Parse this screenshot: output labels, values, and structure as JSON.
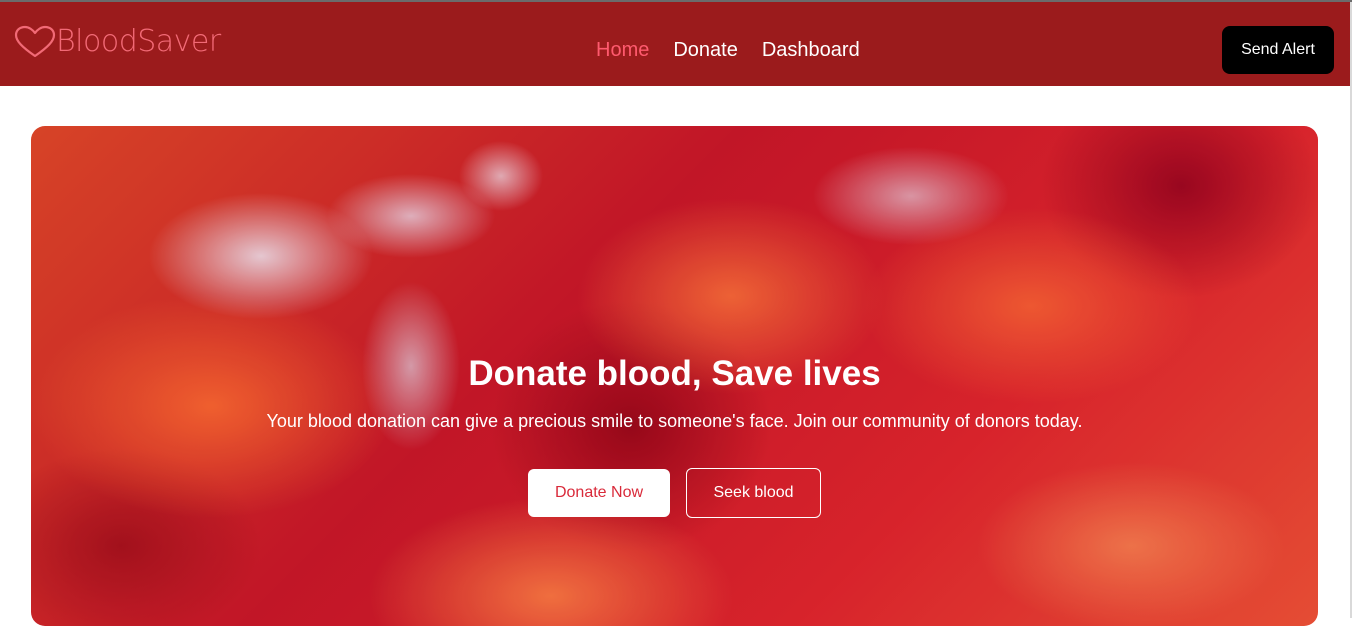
{
  "brand": {
    "name": "BloodSaver",
    "icon": "heart-outline-icon"
  },
  "nav": {
    "items": [
      {
        "label": "Home",
        "active": true
      },
      {
        "label": "Donate",
        "active": false
      },
      {
        "label": "Dashboard",
        "active": false
      }
    ],
    "send_alert_label": "Send Alert"
  },
  "hero": {
    "title": "Donate blood, Save lives",
    "subtitle": "Your blood donation can give a precious smile to someone's face. Join our community of donors today.",
    "donate_now_label": "Donate Now",
    "seek_blood_label": "Seek blood"
  },
  "colors": {
    "navbar_bg": "#9b1b1c",
    "brand": "#f26a76",
    "nav_active": "#ff5a6e",
    "send_alert_bg": "#000000",
    "donate_now_text": "#d92a3a"
  }
}
